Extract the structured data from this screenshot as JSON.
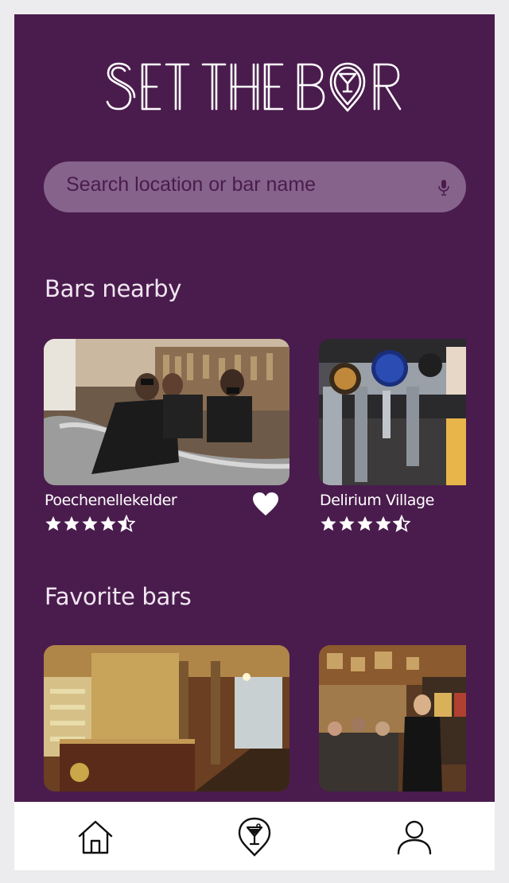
{
  "app": {
    "brand": "SET THE BAR"
  },
  "search": {
    "placeholder": "Search location or bar name"
  },
  "sections": {
    "nearby_title": "Bars nearby",
    "favorites_title": "Favorite bars"
  },
  "nearby_bars": [
    {
      "name": "Poechenellekelder",
      "rating": 4.5,
      "favorite": true
    },
    {
      "name": "Delirium Village",
      "rating": 4.5,
      "favorite": false
    }
  ],
  "favorite_bars": [
    {
      "name": ""
    },
    {
      "name": ""
    }
  ],
  "nav": {
    "items": [
      "home-icon",
      "bar-map-pin-icon",
      "profile-icon"
    ]
  },
  "colors": {
    "background": "#4a1c4d",
    "search_field": "#86638b",
    "text": "#ffffff",
    "nav_background": "#ffffff"
  }
}
